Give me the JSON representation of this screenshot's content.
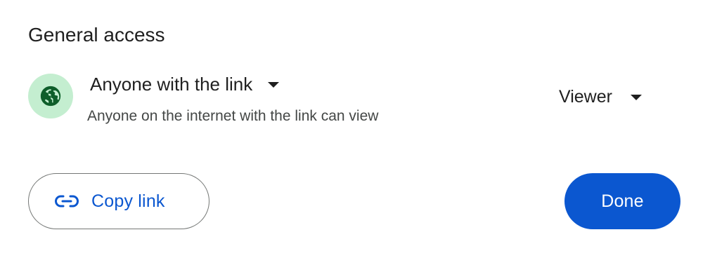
{
  "section": {
    "title": "General access"
  },
  "access": {
    "icon": "globe-icon",
    "icon_bg_color": "#c4eed0",
    "icon_color": "#0e5e2a",
    "selected_option": "Anyone with the link",
    "description": "Anyone on the internet with the link can view"
  },
  "role": {
    "selected_option": "Viewer"
  },
  "actions": {
    "copy_link_label": "Copy link",
    "copy_link_icon": "link-icon",
    "done_label": "Done",
    "accent_color": "#0b57d0"
  }
}
